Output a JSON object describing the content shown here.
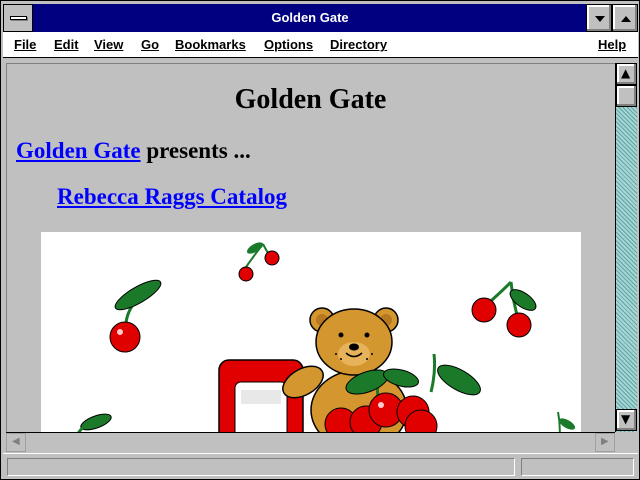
{
  "window": {
    "title": "Golden Gate"
  },
  "menu": {
    "items": [
      "File",
      "Edit",
      "View",
      "Go",
      "Bookmarks",
      "Options",
      "Directory"
    ],
    "help": "Help"
  },
  "page": {
    "heading": "Golden Gate",
    "presents_link": "Golden Gate",
    "presents_text": " presents ...",
    "catalog_link": "Rebecca Raggs Catalog"
  },
  "icons": {
    "system_menu": "system-menu-icon",
    "minimize": "minimize-icon",
    "maximize": "maximize-icon",
    "scroll_up": "scroll-up-icon",
    "scroll_down": "scroll-down-icon",
    "scroll_left": "scroll-left-icon",
    "scroll_right": "scroll-right-icon"
  },
  "colors": {
    "titlebar": "#000080",
    "link": "#0000ff",
    "scroll_track": "#7fbcbc",
    "cherry": "#e00000",
    "leaf": "#1a7a2a",
    "bear": "#d4962e"
  },
  "status": {
    "text": ""
  }
}
